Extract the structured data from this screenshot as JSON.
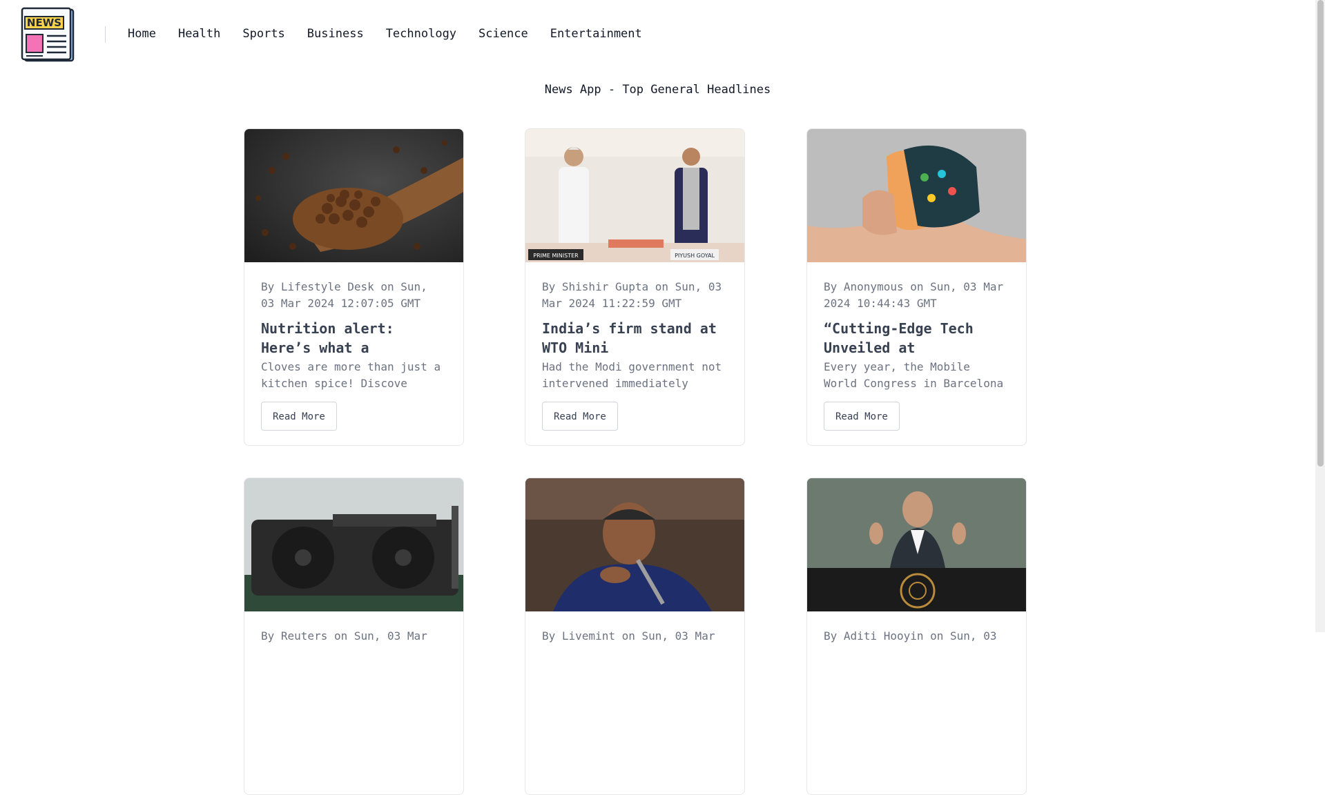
{
  "logo": {
    "text": "NEWS"
  },
  "nav": [
    "Home",
    "Health",
    "Sports",
    "Business",
    "Technology",
    "Science",
    "Entertainment"
  ],
  "page_title": "News App - Top General Headlines",
  "articles": [
    {
      "meta": "By Lifestyle Desk on Sun, 03 Mar 2024 12:07:05 GMT",
      "title": "Nutrition alert: Here’s what a",
      "description": "Cloves are more than just a kitchen spice! Discove",
      "button": "Read More",
      "image": "cloves-in-wooden-spoon"
    },
    {
      "meta": "By Shishir Gupta on Sun, 03 Mar 2024 11:22:59 GMT",
      "title": "India’s firm stand at WTO Mini",
      "description": "Had the Modi government not intervened immediately",
      "button": "Read More",
      "image": "prime-minister-and-piyush-goyal",
      "image_captions": [
        "PRIME MINISTER",
        "PIYUSH GOYAL"
      ]
    },
    {
      "meta": "By Anonymous on Sun, 03 Mar 2024 10:44:43 GMT",
      "title": "“Cutting-Edge Tech Unveiled at",
      "description": "Every year, the Mobile World Congress in Barcelona",
      "button": "Read More",
      "image": "flexible-phone-on-wrist"
    },
    {
      "meta": "By Reuters on Sun, 03 Mar",
      "image": "graphics-card"
    },
    {
      "meta": "By Livemint on Sun, 03 Mar",
      "image": "politician-speaking"
    },
    {
      "meta": "By Aditi Hooyin on Sun, 03",
      "image": "un-general-assembly-speaker"
    }
  ]
}
